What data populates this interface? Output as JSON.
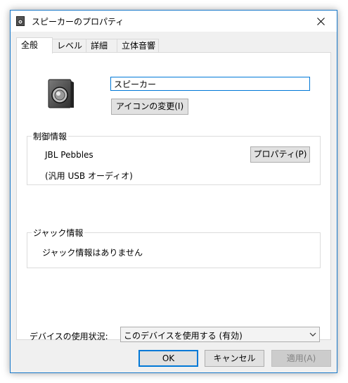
{
  "window": {
    "title": "スピーカーのプロパティ"
  },
  "tabs": [
    {
      "label": "全般",
      "active": true
    },
    {
      "label": "レベル",
      "active": false
    },
    {
      "label": "詳細",
      "active": false
    },
    {
      "label": "立体音響",
      "active": false
    }
  ],
  "general": {
    "name_value": "スピーカー",
    "change_icon_label": "アイコンの変更(I)"
  },
  "controller": {
    "group_label": "制御情報",
    "device_name": "JBL Pebbles",
    "driver": "(汎用 USB オーディオ)",
    "properties_label": "プロパティ(P)"
  },
  "jack": {
    "group_label": "ジャック情報",
    "info": "ジャック情報はありません"
  },
  "usage": {
    "label": "デバイスの使用状況:",
    "selected": "このデバイスを使用する (有効)"
  },
  "footer": {
    "ok": "OK",
    "cancel": "キャンセル",
    "apply": "適用(A)"
  },
  "colors": {
    "accent": "#0078d7",
    "window_border": "#1979ca",
    "disabled_text": "#838383"
  },
  "icons": [
    "speaker-icon",
    "close-icon",
    "chevron-down-icon"
  ]
}
